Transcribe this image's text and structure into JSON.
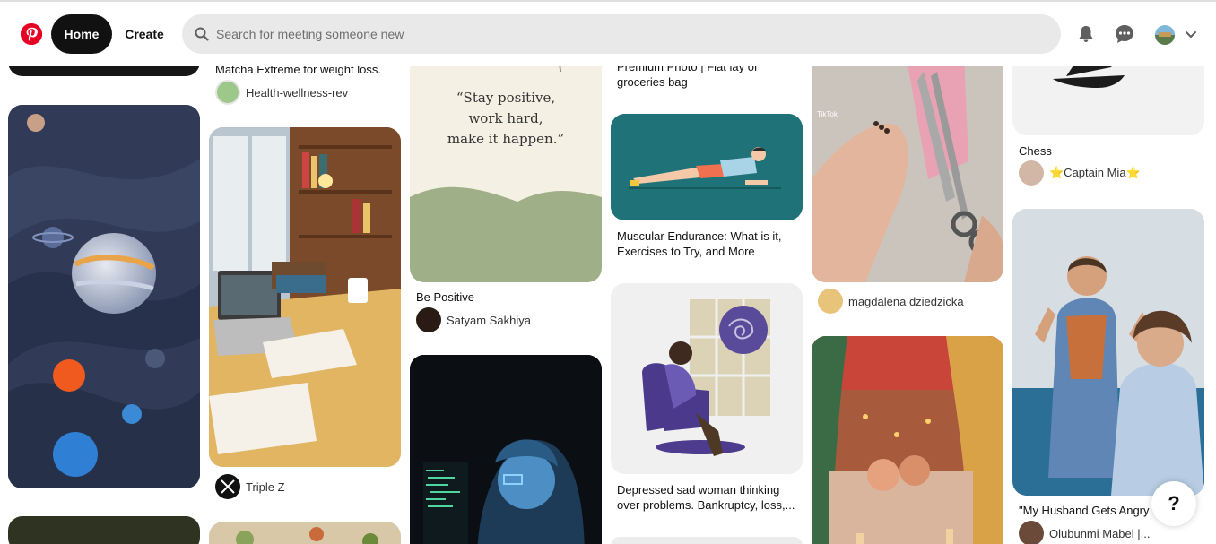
{
  "header": {
    "home_label": "Home",
    "create_label": "Create",
    "search_placeholder": "Search for meeting someone new"
  },
  "pins": {
    "p_matcha_title": "Matcha Extreme for weight loss.",
    "p_matcha_author": "Health-wellness-rev",
    "p_desk_author": "Triple Z",
    "p_quote_text_1": "“Stay positive,",
    "p_quote_text_2": "work hard,",
    "p_quote_text_3": "make it happen.”",
    "p_quote_title": "Be Positive",
    "p_quote_author": "Satyam Sakhiya",
    "p_groceries_title_1": "Premium Photo | Flat lay of",
    "p_groceries_title_2": "groceries bag",
    "p_endurance_title_1": "Muscular Endurance: What is it,",
    "p_endurance_title_2": "Exercises to Try, and More",
    "p_depressed_title_1": "Depressed sad woman thinking",
    "p_depressed_title_2": "over problems. Bankruptcy, loss,...",
    "p_scissors_author": "magdalena dziedzicka",
    "p_chess_title": "Chess",
    "p_chess_author": "⭐Captain Mia⭐",
    "p_husband_title": "\"My Husband Gets Angry ...",
    "p_husband_author": "Olubunmi Mabel |..."
  },
  "help": {
    "label": "?"
  },
  "colors": {
    "brand": "#e60023",
    "home_bg": "#111111",
    "search_bg": "#e9e9e9"
  }
}
